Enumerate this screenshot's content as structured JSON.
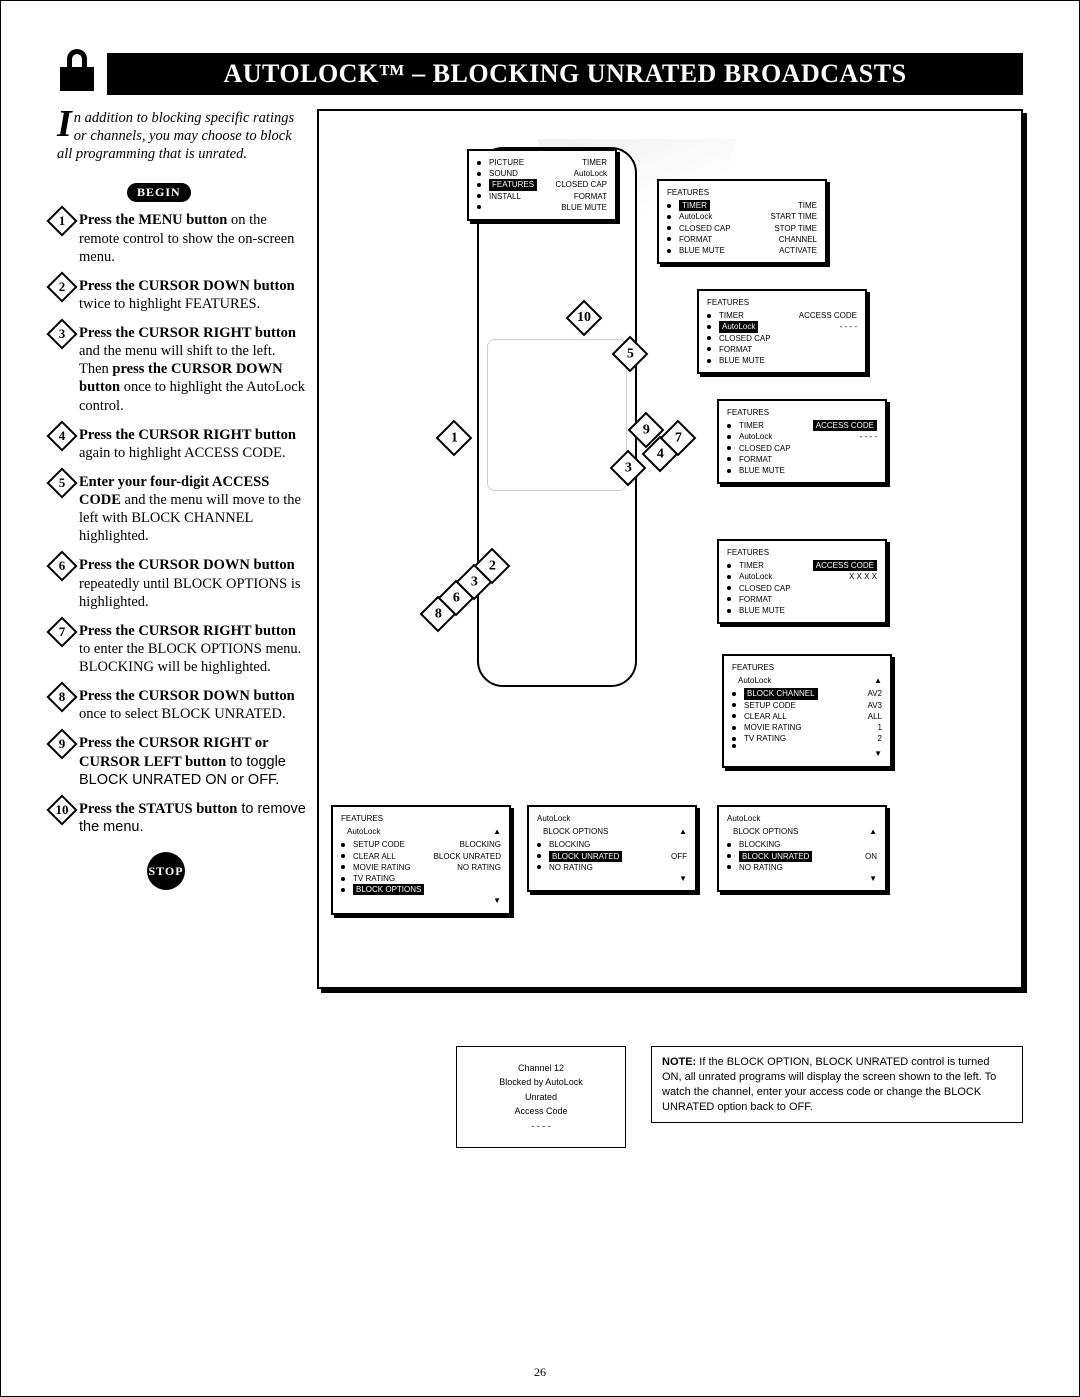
{
  "page_number": "26",
  "title": "AUTOLOCK™ – BLOCKING UNRATED BROADCASTS",
  "intro": {
    "dropcap": "I",
    "rest": "n addition to blocking specific ratings or channels, you may choose to block all programming that is unrated."
  },
  "labels": {
    "begin": "BEGIN",
    "stop": "STOP"
  },
  "steps": [
    {
      "n": "1",
      "bold": "Press the MENU button",
      "rest": " on the remote control to show the on-screen menu."
    },
    {
      "n": "2",
      "bold": "Press the CURSOR DOWN button",
      "rest": " twice to highlight FEATURES."
    },
    {
      "n": "3",
      "bold": "Press the CURSOR RIGHT button",
      "rest": " and the menu will shift to the left. Then ",
      "bold2": "press the CURSOR DOWN button",
      "rest2": " once to highlight the AutoLock control."
    },
    {
      "n": "4",
      "bold": "Press the CURSOR RIGHT button",
      "rest": " again to highlight ACCESS CODE."
    },
    {
      "n": "5",
      "bold": "Enter your four-digit ACCESS CODE",
      "rest": " and the menu will move to the left with BLOCK CHANNEL highlighted."
    },
    {
      "n": "6",
      "bold": "Press the CURSOR DOWN button",
      "rest": " repeatedly until BLOCK OPTIONS is highlighted."
    },
    {
      "n": "7",
      "bold": "Press the CURSOR RIGHT button",
      "rest": " to enter the BLOCK OPTIONS menu. BLOCKING will be highlighted."
    },
    {
      "n": "8",
      "bold": "Press the CURSOR DOWN button",
      "rest": " once to select BLOCK UNRATED."
    },
    {
      "n": "9",
      "bold": "Press the CURSOR RIGHT or CURSOR LEFT button",
      "rest": " to toggle BLOCK UNRATED ON or OFF.",
      "sans": true
    },
    {
      "n": "10",
      "bold": "Press the STATUS button",
      "rest": " to remove the menu.",
      "sans": true
    }
  ],
  "osd": {
    "menu1": {
      "rows": [
        [
          "PICTURE",
          "TIMER"
        ],
        [
          "SOUND",
          "AutoLock"
        ],
        [
          "FEATURES",
          "CLOSED CAP"
        ],
        [
          "INSTALL",
          "FORMAT"
        ],
        [
          "",
          "BLUE MUTE"
        ]
      ],
      "highlight_row": 2
    },
    "menu2": {
      "header": "FEATURES",
      "rows": [
        [
          "TIMER",
          "TIME"
        ],
        [
          "AutoLock",
          "START TIME"
        ],
        [
          "CLOSED CAP",
          "STOP TIME"
        ],
        [
          "FORMAT",
          "CHANNEL"
        ],
        [
          "BLUE MUTE",
          "ACTIVATE"
        ]
      ],
      "highlight_row": 0
    },
    "menu3": {
      "header": "FEATURES",
      "rows": [
        [
          "TIMER",
          "ACCESS CODE"
        ],
        [
          "AutoLock",
          "- - - -"
        ],
        [
          "CLOSED CAP",
          ""
        ],
        [
          "FORMAT",
          ""
        ],
        [
          "BLUE MUTE",
          ""
        ]
      ],
      "highlight_row": 1
    },
    "menu4": {
      "header": "FEATURES",
      "rows": [
        [
          "TIMER",
          "ACCESS CODE"
        ],
        [
          "AutoLock",
          "- - - -"
        ],
        [
          "CLOSED CAP",
          ""
        ],
        [
          "FORMAT",
          ""
        ],
        [
          "BLUE MUTE",
          ""
        ]
      ],
      "highlight_right": 0
    },
    "menu5": {
      "header": "FEATURES",
      "rows": [
        [
          "TIMER",
          "ACCESS CODE"
        ],
        [
          "AutoLock",
          "X X X X"
        ],
        [
          "CLOSED CAP",
          ""
        ],
        [
          "FORMAT",
          ""
        ],
        [
          "BLUE MUTE",
          ""
        ]
      ],
      "highlight_right": 0
    },
    "menu6": {
      "header": "FEATURES",
      "sub": "AutoLock",
      "rows": [
        [
          "BLOCK CHANNEL",
          "AV2"
        ],
        [
          "SETUP CODE",
          "AV3"
        ],
        [
          "CLEAR ALL",
          "ALL"
        ],
        [
          "MOVIE RATING",
          "1"
        ],
        [
          "TV RATING",
          "2"
        ],
        [
          "",
          ""
        ]
      ],
      "highlight_row": 0
    },
    "menu7": {
      "header": "FEATURES",
      "sub": "AutoLock",
      "rows": [
        [
          "SETUP CODE",
          "BLOCKING"
        ],
        [
          "CLEAR ALL",
          "BLOCK UNRATED"
        ],
        [
          "MOVIE RATING",
          "NO RATING"
        ],
        [
          "TV RATING",
          ""
        ],
        [
          "BLOCK OPTIONS",
          ""
        ]
      ],
      "highlight_row": 4
    },
    "menu8": {
      "header": "AutoLock",
      "sub": "BLOCK OPTIONS",
      "rows": [
        [
          "BLOCKING",
          ""
        ],
        [
          "BLOCK UNRATED",
          "OFF"
        ],
        [
          "NO RATING",
          ""
        ]
      ],
      "highlight_row": 1
    },
    "menu9": {
      "header": "AutoLock",
      "sub": "BLOCK OPTIONS",
      "rows": [
        [
          "BLOCKING",
          ""
        ],
        [
          "BLOCK UNRATED",
          "ON"
        ],
        [
          "NO RATING",
          ""
        ]
      ],
      "highlight_row": 1
    }
  },
  "blocked_screen": {
    "line1": "Channel 12",
    "line2": "Blocked by AutoLock",
    "line3": "Unrated",
    "line4": "Access Code",
    "line5": "- - - -"
  },
  "note": {
    "bold": "NOTE:",
    "text": " If the BLOCK OPTION, BLOCK UNRATED control is turned ON, all unrated programs will display the screen shown to the left. To watch the channel, enter your access code or change the BLOCK UNRATED option back to OFF."
  }
}
